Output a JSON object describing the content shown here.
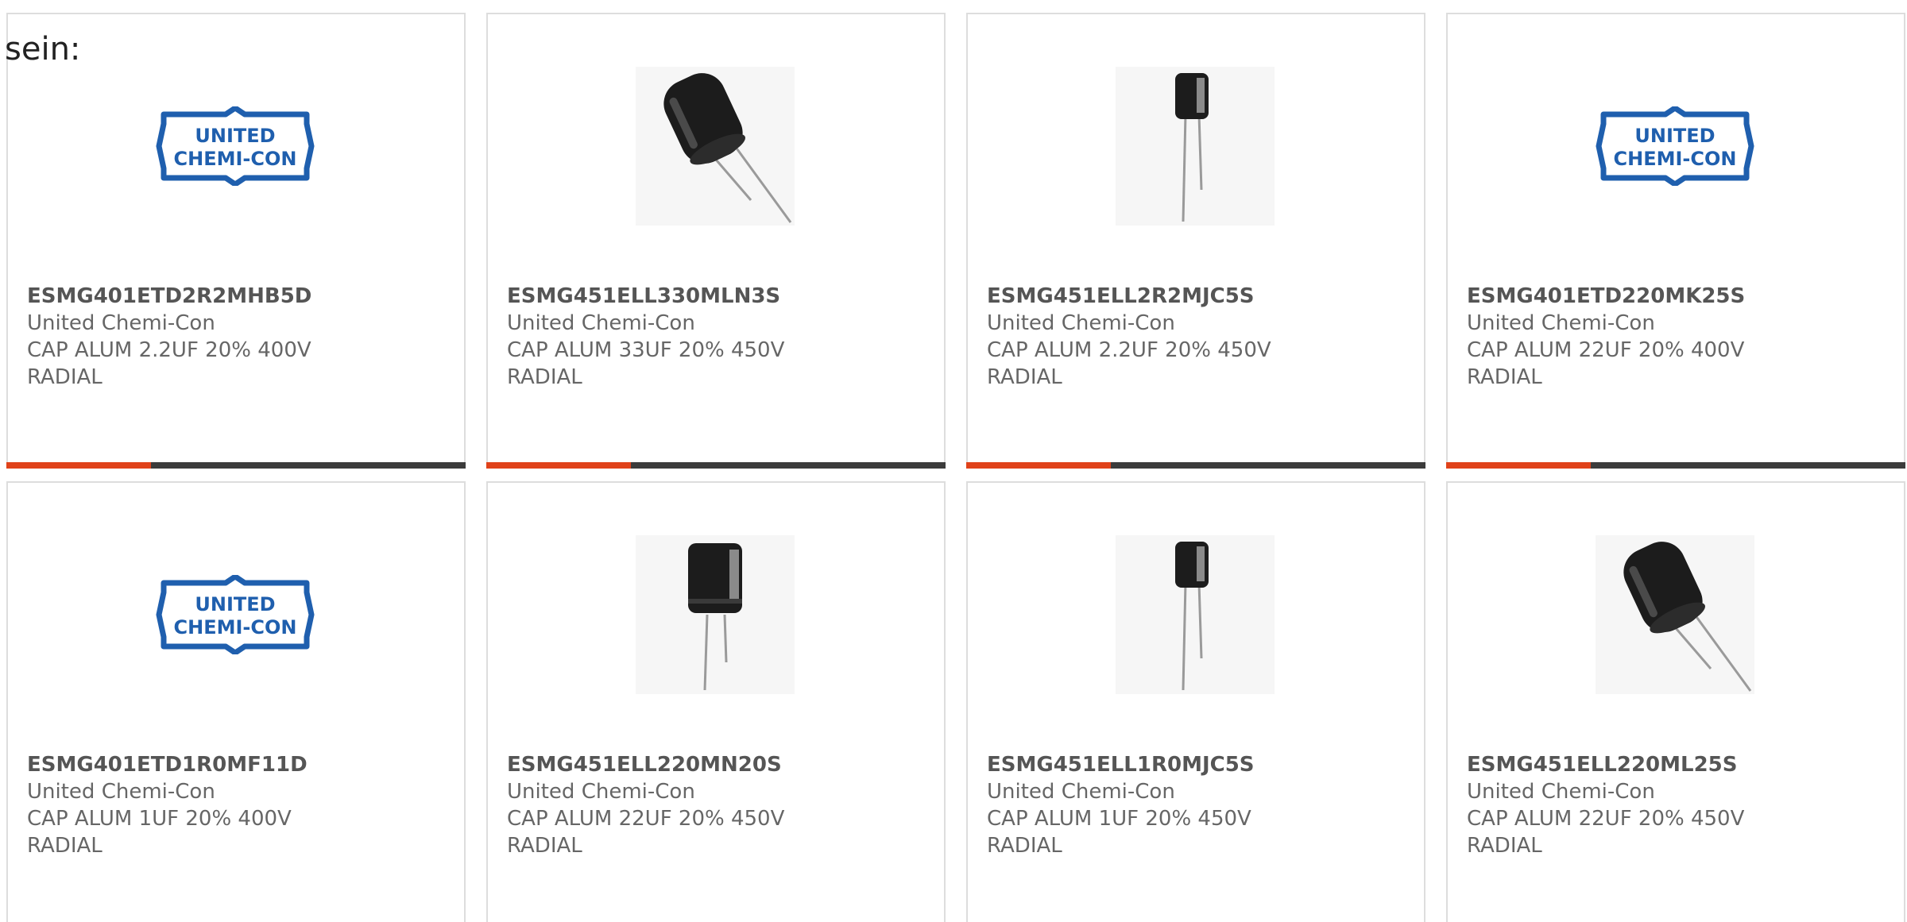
{
  "intro": {
    "text": "sein:"
  },
  "colors": {
    "accent": "#e0421a",
    "bar_dark": "#3c3c3c",
    "card_border": "#dddddd",
    "logo_blue": "#1f5fae"
  },
  "products": [
    {
      "part_number": "ESMG401ETD2R2MHB5D",
      "manufacturer": "United Chemi-Con",
      "description": "CAP ALUM 2.2UF 20% 400V",
      "package": "RADIAL",
      "image": "logo",
      "logo_line1": "UNITED",
      "logo_line2": "CHEMI-CON"
    },
    {
      "part_number": "ESMG451ELL330MLN3S",
      "manufacturer": "United Chemi-Con",
      "description": "CAP ALUM 33UF 20% 450V",
      "package": "RADIAL",
      "image": "capacitor-large-tilted"
    },
    {
      "part_number": "ESMG451ELL2R2MJC5S",
      "manufacturer": "United Chemi-Con",
      "description": "CAP ALUM 2.2UF 20% 450V",
      "package": "RADIAL",
      "image": "capacitor-small"
    },
    {
      "part_number": "ESMG401ETD220MK25S",
      "manufacturer": "United Chemi-Con",
      "description": "CAP ALUM 22UF 20% 400V",
      "package": "RADIAL",
      "image": "logo",
      "logo_line1": "UNITED",
      "logo_line2": "CHEMI-CON"
    },
    {
      "part_number": "ESMG401ETD1R0MF11D",
      "manufacturer": "United Chemi-Con",
      "description": "CAP ALUM 1UF 20% 400V",
      "package": "RADIAL",
      "image": "logo",
      "logo_line1": "UNITED",
      "logo_line2": "CHEMI-CON"
    },
    {
      "part_number": "ESMG451ELL220MN20S",
      "manufacturer": "United Chemi-Con",
      "description": "CAP ALUM 22UF 20% 450V",
      "package": "RADIAL",
      "image": "capacitor-medium"
    },
    {
      "part_number": "ESMG451ELL1R0MJC5S",
      "manufacturer": "United Chemi-Con",
      "description": "CAP ALUM 1UF 20% 450V",
      "package": "RADIAL",
      "image": "capacitor-small"
    },
    {
      "part_number": "ESMG451ELL220ML25S",
      "manufacturer": "United Chemi-Con",
      "description": "CAP ALUM 22UF 20% 450V",
      "package": "RADIAL",
      "image": "capacitor-large-tilted"
    }
  ]
}
